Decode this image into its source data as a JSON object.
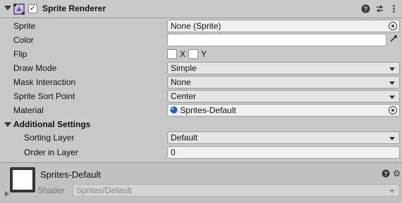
{
  "header": {
    "title": "Sprite Renderer",
    "enabled_mark": "✓",
    "help_glyph": "?",
    "presets_glyph": "⇅",
    "menu_glyph": "⋮"
  },
  "rows": {
    "sprite": {
      "label": "Sprite",
      "value": "None (Sprite)"
    },
    "color": {
      "label": "Color",
      "value": "#ffffff"
    },
    "flip": {
      "label": "Flip",
      "x_label": "X",
      "y_label": "Y"
    },
    "draw_mode": {
      "label": "Draw Mode",
      "value": "Simple"
    },
    "mask_interaction": {
      "label": "Mask Interaction",
      "value": "None"
    },
    "sprite_sort_point": {
      "label": "Sprite Sort Point",
      "value": "Center"
    },
    "material": {
      "label": "Material",
      "value": "Sprites-Default"
    }
  },
  "additional_settings": {
    "label": "Additional Settings",
    "sorting_layer": {
      "label": "Sorting Layer",
      "value": "Default"
    },
    "order_in_layer": {
      "label": "Order in Layer",
      "value": "0"
    }
  },
  "material_preview": {
    "name": "Sprites-Default",
    "shader_label": "Shader",
    "shader_value": "Sprites/Default",
    "help_glyph": "?",
    "settings_glyph": "⚙"
  },
  "icons": {
    "component": "sprite-renderer-icon",
    "eyedropper": "eyedropper-icon",
    "object_picker": "object-picker-icon",
    "material": "material-sphere-icon"
  }
}
